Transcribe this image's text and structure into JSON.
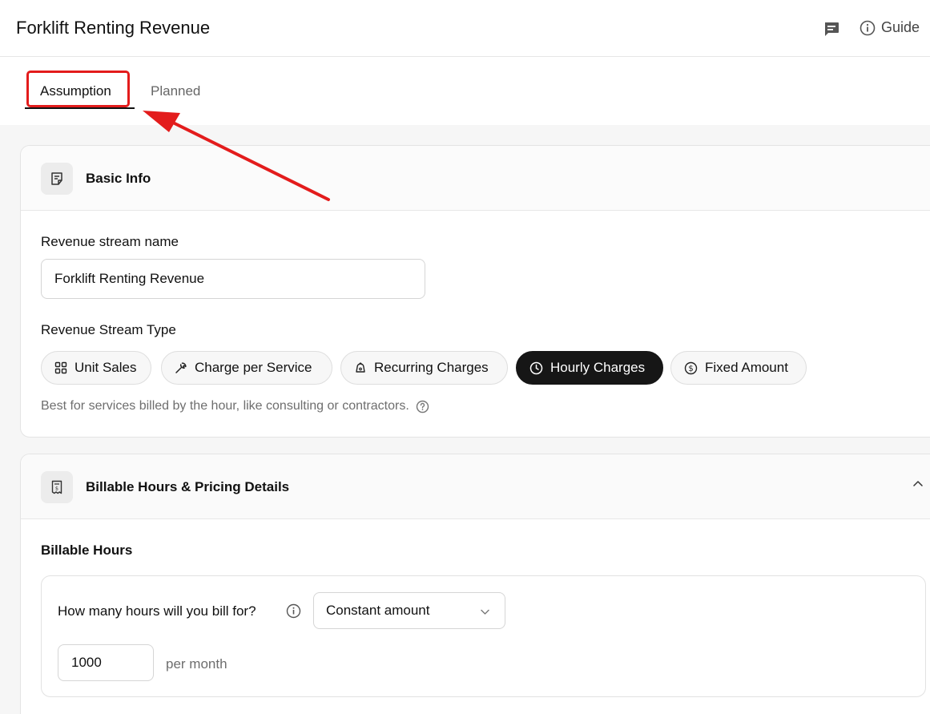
{
  "header": {
    "title": "Forklift Renting Revenue",
    "chat_icon": "chat-icon",
    "guide_label": "Guide",
    "guide_icon": "info-icon"
  },
  "tabs": [
    {
      "label": "Assumption",
      "active": true
    },
    {
      "label": "Planned",
      "active": false
    }
  ],
  "annotation": {
    "color": "#e31c1c"
  },
  "basic_info": {
    "title": "Basic Info",
    "icon": "document-icon",
    "name_label": "Revenue stream name",
    "name_value": "Forklift Renting Revenue",
    "type_label": "Revenue Stream Type",
    "types": [
      {
        "label": "Unit Sales",
        "icon": "grid-icon",
        "active": false
      },
      {
        "label": "Charge per Service",
        "icon": "wrench-icon",
        "active": false
      },
      {
        "label": "Recurring Charges",
        "icon": "recurring-icon",
        "active": false
      },
      {
        "label": "Hourly Charges",
        "icon": "clock-icon",
        "active": true
      },
      {
        "label": "Fixed Amount",
        "icon": "dollar-icon",
        "active": false
      }
    ],
    "hint": "Best for services billed by the hour, like consulting or contractors."
  },
  "billable": {
    "title": "Billable Hours & Pricing Details",
    "icon": "receipt-icon",
    "section_label": "Billable Hours",
    "question": "How many hours will you bill for?",
    "select_value": "Constant amount",
    "hours_value": "1000",
    "unit": "per month"
  },
  "colors": {
    "active_chip": "#161616",
    "highlight": "#e31c1c"
  }
}
